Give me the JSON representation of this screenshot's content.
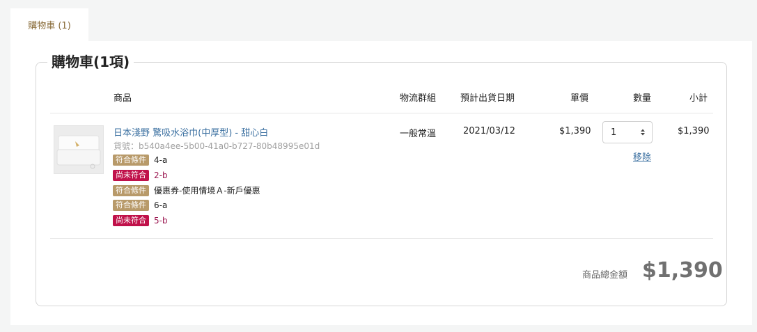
{
  "tab": {
    "label": "購物車 (1)"
  },
  "cart": {
    "legend": "購物車(1項)",
    "headers": {
      "product": "商品",
      "logistics": "物流群組",
      "ship_date": "預計出貨日期",
      "unit_price": "單價",
      "quantity": "數量",
      "subtotal": "小計"
    },
    "items": [
      {
        "name": "日本淺野 驚吸水浴巾(中厚型) - 甜心白",
        "sku": "貨號：b540a4ee-5b00-41a0-b727-80b48995e01d",
        "conditions": [
          {
            "badge": "符合條件",
            "text": "4-a",
            "status": "met"
          },
          {
            "badge": "尚未符合",
            "text": "2-b",
            "status": "unmet"
          },
          {
            "badge": "符合條件",
            "text": "優惠券-使用情境Ａ-新戶優惠",
            "status": "met"
          },
          {
            "badge": "符合條件",
            "text": "6-a",
            "status": "met"
          },
          {
            "badge": "尚未符合",
            "text": "5-b",
            "status": "unmet"
          }
        ],
        "logistics": "一般常溫",
        "ship_date": "2021/03/12",
        "unit_price": "$1,390",
        "quantity": "1",
        "subtotal": "$1,390",
        "remove_label": "移除",
        "thumbnail_icon": "towel-product-image"
      }
    ],
    "total_label": "商品總金額",
    "total_value": "$1,390"
  },
  "colors": {
    "link": "#3a6fa0",
    "badge_met": "#b89a6a",
    "badge_unmet": "#c0114a",
    "unmet_text": "#9b1750",
    "tab_text": "#8a6d3b"
  }
}
